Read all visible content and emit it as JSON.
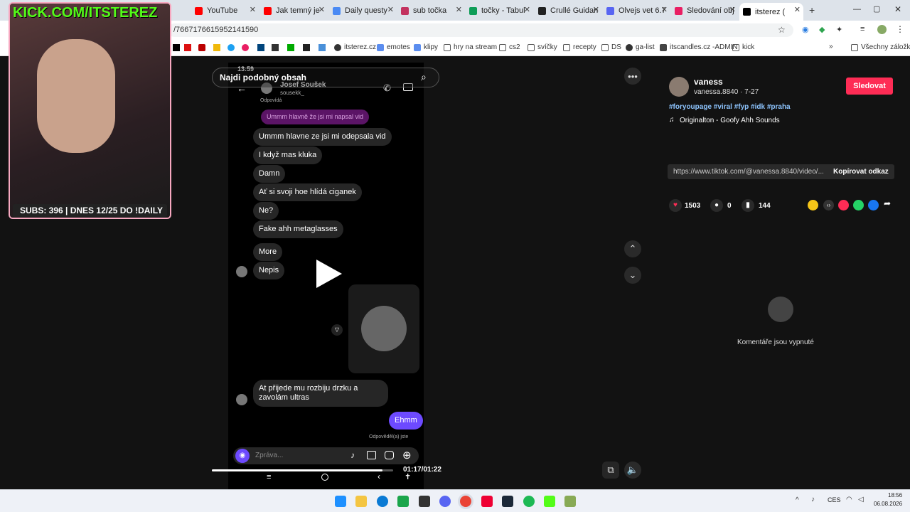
{
  "browser": {
    "tabs": [
      {
        "label": "YouTube",
        "color": "#ff0000"
      },
      {
        "label": "Jak temný je",
        "color": "#ff0000"
      },
      {
        "label": "Daily questy",
        "color": "#4a8af4"
      },
      {
        "label": "sub točka",
        "color": "#c3325f"
      },
      {
        "label": "točky - Tabul",
        "color": "#0f9d58"
      },
      {
        "label": "Crullé Guidan",
        "color": "#222222"
      },
      {
        "label": "Olvejs vet 6.7",
        "color": "#5865f2"
      },
      {
        "label": "Sledování obj",
        "color": "#e91e63"
      },
      {
        "label": "itsterez (",
        "color": "#000000"
      }
    ],
    "url": "/7667176615952141590",
    "bookmarks": [
      "itsterez.cz",
      "emotes",
      "klipy",
      "hry na stream",
      "cs2",
      "svíčky",
      "recepty",
      "DS",
      "ga-list",
      "itscandles.cz -ADMIN",
      "kick",
      "Všechny záložky"
    ]
  },
  "overlay": {
    "kick_title": "KICK.COM/ITSTEREZ",
    "subs_text": "SUBS: 396 | DNES 12/25 DO !DAILY"
  },
  "video": {
    "search_label": "Najdi podobný obsah",
    "time": "01:17/01:22",
    "progress": 0.94
  },
  "phone": {
    "status_time": "13:59",
    "contact_name": "Josef Soušek",
    "contact_handle": "sousekk_",
    "reply_label": "Odpovídá",
    "reply_quote": "Ummm hlavně že jsi mi napsal vid",
    "messages": [
      "Ummm hlavne ze jsi mi odepsala vid",
      "I když mas kluka",
      "Damn",
      "Ať si svoji hoe hlídá ciganek",
      "Ne?",
      "Fake ahh metaglasses",
      "More",
      "Nepis"
    ],
    "last_message": "At přijede mu rozbiju drzku a zavolám ultras",
    "sent_message": "Ehmm",
    "replied_label": "Odpověděl(a) jste",
    "input_placeholder": "Zpráva..."
  },
  "post": {
    "username": "vaness",
    "handle": "vanessa.8840 · 7-27",
    "follow_label": "Sledovat",
    "hashtags": "#foryoupage #viral #fyp #idk #praha",
    "sound": "Originalton - Goofy Ahh Sounds",
    "likes": "1503",
    "comments": "0",
    "saves": "144",
    "link": "https://www.tiktok.com/@vanessa.8840/video/...",
    "copy_label": "Kopírovat odkaz",
    "comments_off": "Komentáře jsou vypnuté"
  },
  "taskbar": {
    "lang": "CES",
    "time": "18:56",
    "date": "06.08.2026"
  }
}
